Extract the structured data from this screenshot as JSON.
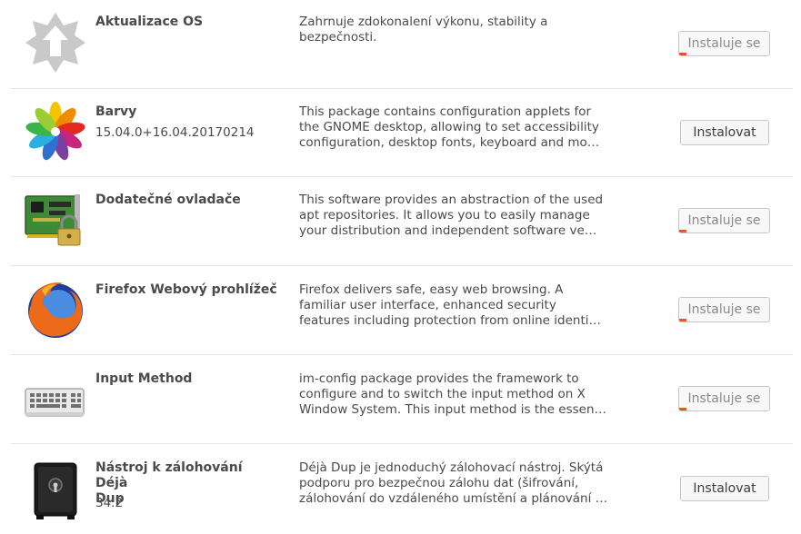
{
  "packages": [
    {
      "name_lines": [
        "Aktualizace OS"
      ],
      "version": "",
      "desc_lines": [
        "Zahrnuje zdokonalení výkonu, stability a",
        "bezpečnosti."
      ],
      "action": "Instaluje se",
      "state": "installing",
      "progress": 0.08,
      "icon": "os-update-icon"
    },
    {
      "name_lines": [
        "Barvy"
      ],
      "version": "15.04.0+16.04.20170214",
      "desc_lines": [
        "This package contains configuration applets for",
        "the GNOME desktop, allowing to set accessibility",
        "configuration, desktop fonts, keyboard and mo…"
      ],
      "action": "Instalovat",
      "state": "available",
      "icon": "color-flower-icon"
    },
    {
      "name_lines": [
        "Dodatečné ovladače"
      ],
      "version": "",
      "desc_lines": [
        "This software provides an abstraction of the used",
        "apt repositories. It allows you to easily manage",
        "your distribution and independent software ve…"
      ],
      "action": "Instaluje se",
      "state": "installing",
      "progress": 0.08,
      "icon": "driver-card-icon"
    },
    {
      "name_lines": [
        "Firefox Webový prohlížeč"
      ],
      "version": "",
      "desc_lines": [
        "Firefox delivers safe, easy web browsing. A",
        "familiar user interface, enhanced security",
        "features including protection from online identi…"
      ],
      "action": "Instaluje se",
      "state": "installing",
      "progress": 0.08,
      "icon": "firefox-icon"
    },
    {
      "name_lines": [
        "Input Method"
      ],
      "version": "",
      "desc_lines": [
        "im-config package provides the framework to",
        "configure and to switch the input method on X",
        "Window System. This input method is the essen…"
      ],
      "action": "Instaluje se",
      "state": "installing",
      "progress": 0.08,
      "icon": "keyboard-icon"
    },
    {
      "name_lines": [
        "Nástroj k zálohování Déjà",
        "Dup"
      ],
      "version": "34.2",
      "desc_lines": [
        "Déjà Dup je jednoduchý zálohovací nástroj. Skýtá",
        "podporu pro bezpečnou zálohu dat (šifrování,",
        "zálohování do vzdáleného umístění a plánování …"
      ],
      "action": "Instalovat",
      "state": "available",
      "icon": "backup-safe-icon"
    }
  ],
  "colors": {
    "progress_accent": "#e95420",
    "separator": "#e6e6e6",
    "text": "#4a4a4a"
  }
}
